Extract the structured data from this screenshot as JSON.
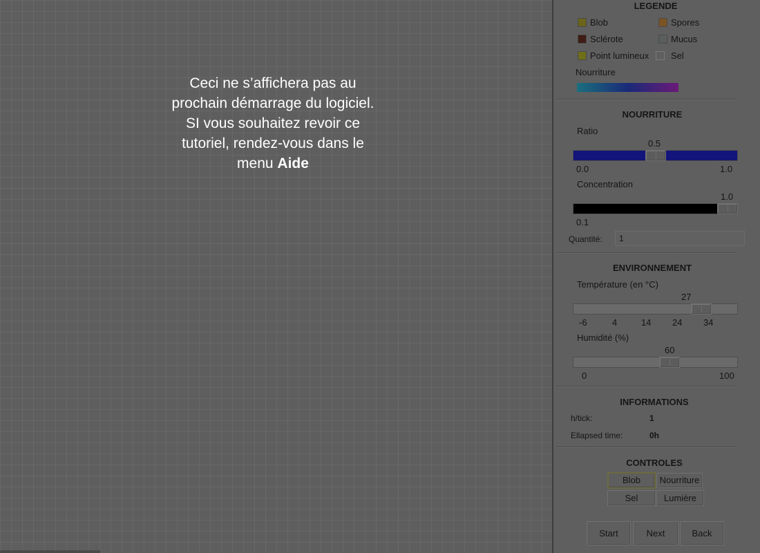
{
  "overlay": {
    "message_lines": [
      "Ceci ne s’affichera pas au",
      "prochain démarrage du logiciel.",
      "SI vous souhaitez revoir ce",
      "tutoriel, rendez-vous dans le"
    ],
    "message_prefix": "menu ",
    "message_bold": "Aide"
  },
  "legend": {
    "title": "LEGENDE",
    "items": [
      {
        "label": "Blob",
        "color": "#6b641a"
      },
      {
        "label": "Spores",
        "color": "#7a5424"
      },
      {
        "label": "Sclérote",
        "color": "#3f1d14"
      },
      {
        "label": "Mucus",
        "color": "#5a5f5c"
      },
      {
        "label": "Point lumineux",
        "color": "#6f6f1a"
      },
      {
        "label": "Sel",
        "color": "#5f5f5f"
      }
    ],
    "food_label": "Nourriture",
    "food_gradient": [
      "#1a6f7e",
      "#1a2a78",
      "#6a1a78"
    ]
  },
  "food": {
    "title": "NOURRITURE",
    "ratio": {
      "label": "Ratio",
      "value": "0.5",
      "fraction": 0.5,
      "min": "0.0",
      "max": "1.0",
      "color": "#13157a"
    },
    "concentration": {
      "label": "Concentration",
      "value": "1.0",
      "fraction": 1.0,
      "min": "0.1",
      "color": "#000000"
    },
    "quantity": {
      "label": "Quantité:",
      "value": "1"
    }
  },
  "environment": {
    "title": "ENVIRONNEMENT",
    "temperature": {
      "label": "Température (en °C)",
      "value": "27",
      "fraction": 0.82,
      "ticks": [
        "-6",
        "4",
        "14",
        "24",
        "34"
      ]
    },
    "humidity": {
      "label": "Humidité (%)",
      "value": "60",
      "fraction": 0.6,
      "min": "0",
      "max": "100"
    }
  },
  "informations": {
    "title": "INFORMATIONS",
    "h_tick_label": "h/tick:",
    "h_tick_value": "1",
    "elapsed_label": "Ellapsed time:",
    "elapsed_value": "0h"
  },
  "controls": {
    "title": "CONTROLES",
    "blob": "Blob",
    "food": "Nourriture",
    "salt": "Sel",
    "light": "Lumière",
    "selected": "Blob"
  },
  "nav": {
    "start": "Start",
    "next": "Next",
    "back": "Back"
  }
}
